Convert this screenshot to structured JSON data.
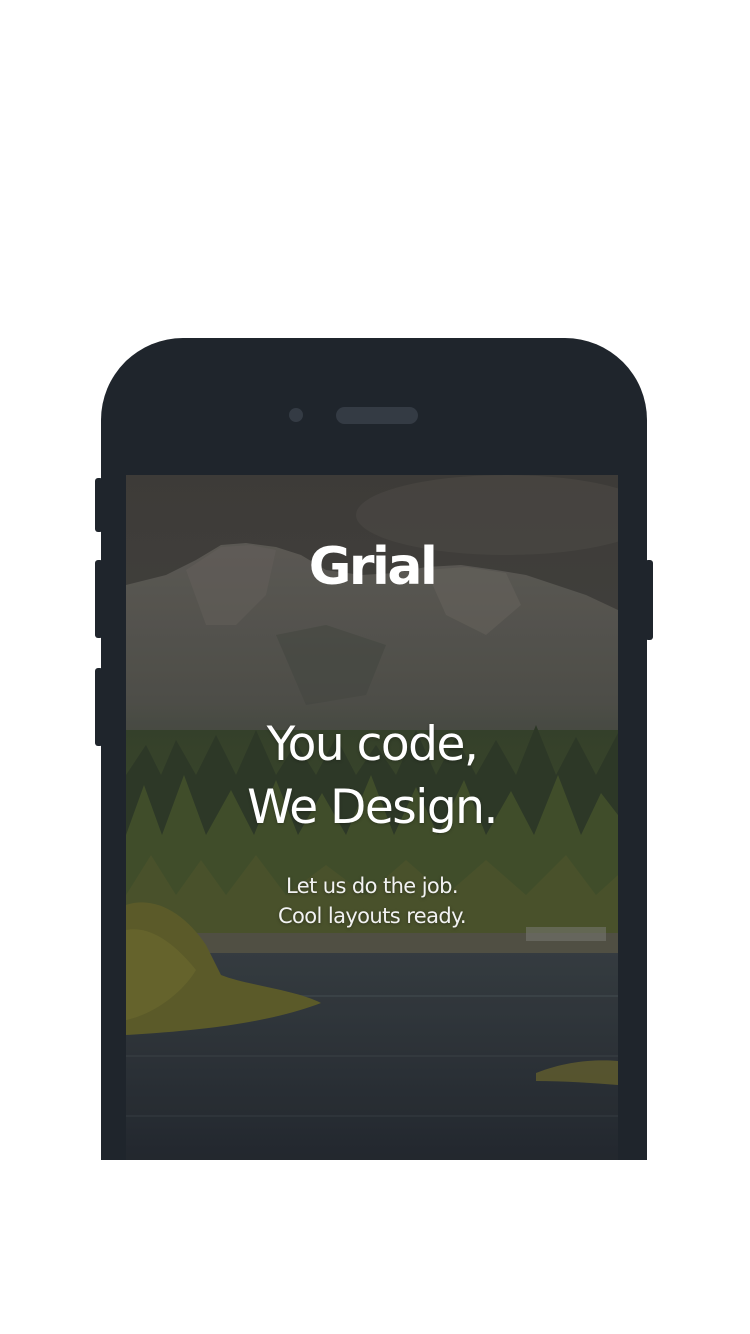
{
  "app": {
    "logo": "Grial"
  },
  "hero": {
    "headline_line1": "You code,",
    "headline_line2": "We Design."
  },
  "tagline": {
    "line1": "Let us do the job.",
    "line2": "Cool layouts ready."
  },
  "colors": {
    "page_background": "#ffffff",
    "phone_body": "#1f252c",
    "phone_detail": "#343b44",
    "text": "#ffffff"
  }
}
